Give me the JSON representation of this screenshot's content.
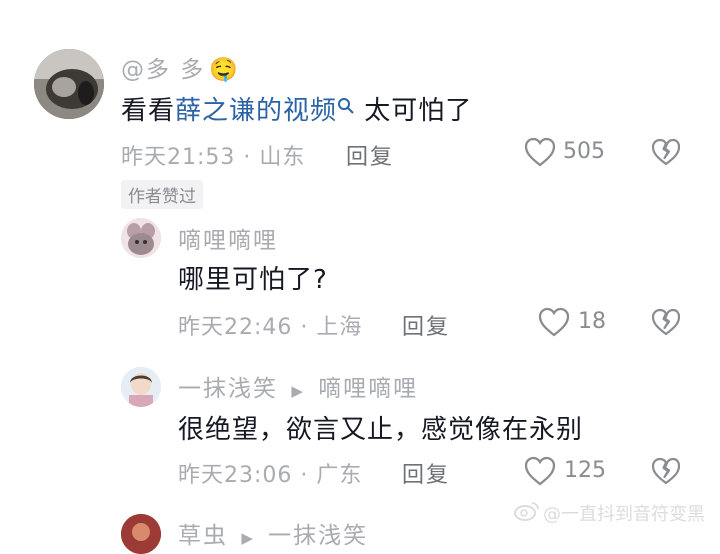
{
  "comment1": {
    "username": "@多 多",
    "emoji": "🤤",
    "text_before": "看看",
    "link_text": "薛之谦的视频",
    "text_after": " 太可怕了",
    "meta": "昨天21:53 · 山东",
    "reply_label": "回复",
    "likes": "505",
    "badge": "作者赞过"
  },
  "reply1": {
    "username": "嘀哩嘀哩",
    "text": "哪里可怕了?",
    "meta": "昨天22:46 · 上海",
    "reply_label": "回复",
    "likes": "18"
  },
  "reply2": {
    "username": "一抹浅笑",
    "arrow": "▶",
    "reply_to": "嘀哩嘀哩",
    "text": "很绝望，欲言又止，感觉像在永别",
    "meta": "昨天23:06 · 广东",
    "reply_label": "回复",
    "likes": "125"
  },
  "reply3": {
    "username": "草虫",
    "arrow": "▶",
    "reply_to": "一抹浅笑"
  },
  "watermark": "@一直抖到音符变黑",
  "icons": {
    "like": "heart-outline-icon",
    "dislike": "broken-heart-icon",
    "search": "search-icon",
    "weibo": "weibo-logo-icon"
  },
  "colors": {
    "link": "#2b63a6",
    "muted": "#a9abb1",
    "text": "#161823"
  }
}
